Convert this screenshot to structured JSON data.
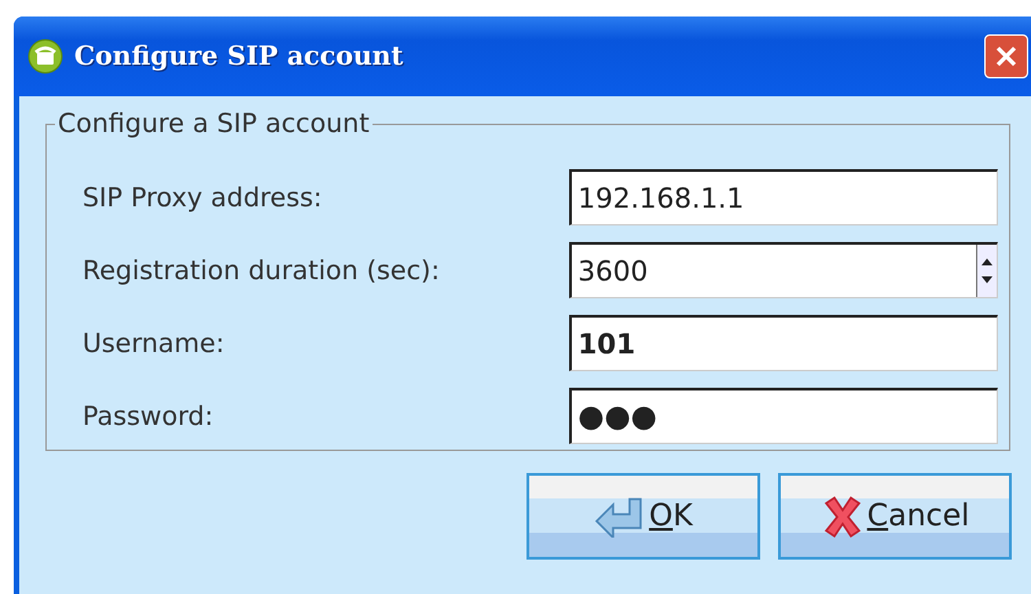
{
  "window": {
    "title": "Configure SIP account"
  },
  "group": {
    "title": "Configure a SIP account"
  },
  "fields": [
    {
      "label": "SIP Proxy address:",
      "value": "192.168.1.1",
      "kind": "text"
    },
    {
      "label": "Registration duration (sec):",
      "value": "3600",
      "kind": "spin"
    },
    {
      "label": "Username:",
      "value": "101",
      "kind": "text"
    },
    {
      "label": "Password:",
      "value": "●●●",
      "kind": "password"
    }
  ],
  "buttons": [
    {
      "label": "OK",
      "kind": "ok"
    },
    {
      "label": "Cancel",
      "kind": "cancel"
    }
  ]
}
